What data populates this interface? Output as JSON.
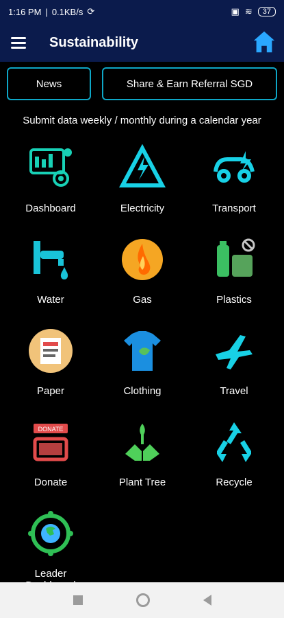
{
  "status": {
    "time": "1:16 PM",
    "speed": "0.1KB/s",
    "battery": "37"
  },
  "appbar": {
    "title": "Sustainability",
    "menu_icon": "hamburger-menu-icon",
    "home_icon": "home-icon"
  },
  "buttons": {
    "news": "News",
    "share": "Share & Earn Referral SGD"
  },
  "subtitle": "Submit data weekly / monthly during a calendar year",
  "tiles": [
    {
      "label": "Dashboard"
    },
    {
      "label": "Electricity"
    },
    {
      "label": "Transport"
    },
    {
      "label": "Water"
    },
    {
      "label": "Gas"
    },
    {
      "label": "Plastics"
    },
    {
      "label": "Paper"
    },
    {
      "label": "Clothing"
    },
    {
      "label": "Travel"
    },
    {
      "label": "Donate",
      "badge": "DONATE"
    },
    {
      "label": "Plant Tree"
    },
    {
      "label": "Recycle"
    },
    {
      "label": "Leader Dashboard"
    }
  ],
  "colors": {
    "bar": "#0b1b4c",
    "accent": "#0ea7c7"
  }
}
